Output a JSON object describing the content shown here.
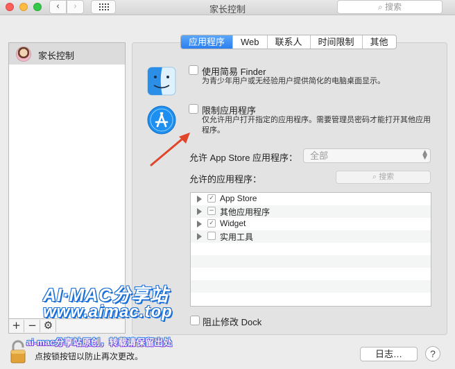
{
  "window": {
    "title": "家长控制",
    "search_placeholder": "搜索"
  },
  "sidebar": {
    "items": [
      {
        "label": "家长控制",
        "selected": true
      }
    ],
    "tools": {
      "add": "+",
      "remove": "−",
      "settings": "⚙"
    }
  },
  "tabs": [
    {
      "label": "应用程序",
      "active": true
    },
    {
      "label": "Web",
      "active": false
    },
    {
      "label": "联系人",
      "active": false
    },
    {
      "label": "时间限制",
      "active": false
    },
    {
      "label": "其他",
      "active": false
    }
  ],
  "options": {
    "simple_finder": {
      "label": "使用简易 Finder",
      "checked": false,
      "description": "为青少年用户或无经验用户提供简化的电脑桌面显示。"
    },
    "limit_apps": {
      "label": "限制应用程序",
      "checked": false,
      "description": "仅允许用户打开指定的应用程序。需要管理员密码才能打开其他应用程序。"
    }
  },
  "app_store_row": {
    "label": "允许 App Store 应用程序：",
    "selected": "全部"
  },
  "allowed_apps": {
    "label": "允许的应用程序：",
    "search_placeholder": "搜索",
    "items": [
      {
        "label": "App Store",
        "state": "✓"
      },
      {
        "label": "其他应用程序",
        "state": "−"
      },
      {
        "label": "Widget",
        "state": "✓"
      },
      {
        "label": "实用工具",
        "state": ""
      }
    ]
  },
  "dock": {
    "label": "阻止修改 Dock",
    "checked": false
  },
  "watermark": {
    "line1": "AI·MAC分享站",
    "line2": "www.aimac.top",
    "line3": "ai-mac分享站原创，转载请保留出处"
  },
  "footer": {
    "lock_text": "点按锁按钮以防止再次更改。",
    "log_button": "日志…",
    "help_button": "?"
  },
  "colors": {
    "accent": "#2b7ff0",
    "arrow": "#e0452a",
    "watermark": "#1b6fd6"
  }
}
